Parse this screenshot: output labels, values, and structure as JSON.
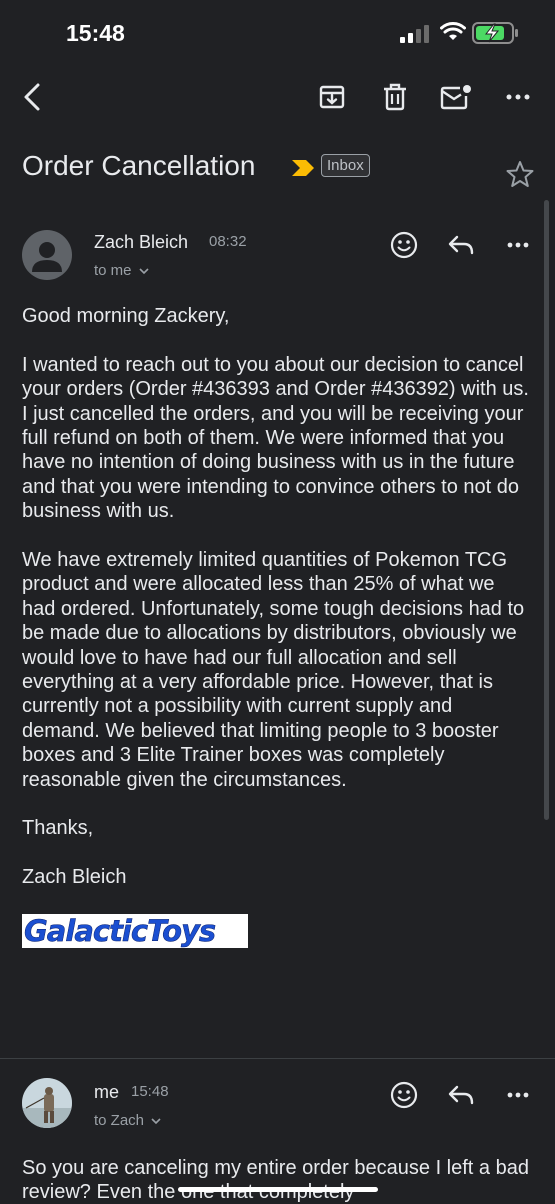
{
  "status": {
    "time": "15:48"
  },
  "toolbar": {
    "back": "back-arrow",
    "archive": "archive",
    "delete": "trash",
    "mark_unread": "mail-unread",
    "more": "more"
  },
  "subject": {
    "title": "Order Cancellation",
    "label": "Inbox"
  },
  "message1": {
    "sender": "Zach Bleich",
    "time": "08:32",
    "to": "to me",
    "greeting": "Good morning Zackery,",
    "paragraph1": "I wanted to reach out to you about our decision to cancel your orders (Order #436393 and Order #436392) with us.  I just cancelled the orders, and you will be receiving your full refund on both of them.  We were informed that you have no intention of doing business with us in the future and that you were intending to convince others to not do business with us.",
    "paragraph2": "We have extremely limited quantities of Pokemon TCG product and were allocated less than 25% of what we had ordered.  Unfortunately, some tough decisions had to be made due to allocations by distributors, obviously we would love to have had our full allocation and sell everything at a very affordable price.  However, that is currently not a possibility with current supply and demand.  We believed that limiting people to 3 booster boxes and 3 Elite Trainer boxes was completely reasonable given the circumstances.",
    "closing": "Thanks,",
    "signature": "Zach Bleich",
    "logo_text": "GalacticToys"
  },
  "message2": {
    "sender": "me",
    "time": "15:48",
    "to": "to Zach",
    "body_preview": "So you are canceling my entire order because I left a bad review? Even the one that completely"
  },
  "colors": {
    "background": "#202124",
    "text": "#e8eaed",
    "secondary": "#9aa0a6",
    "importance": "#fbbc04",
    "logo_blue": "#1b4fd1"
  }
}
